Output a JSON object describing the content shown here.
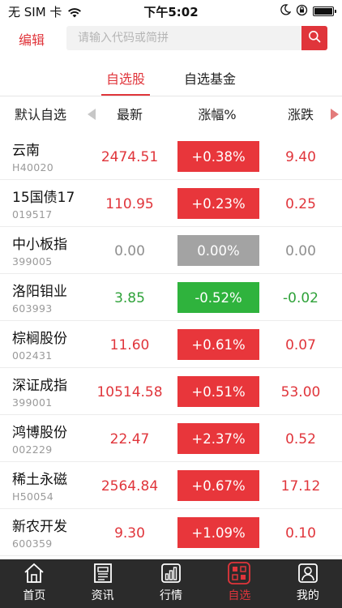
{
  "status_bar": {
    "carrier": "无 SIM 卡",
    "time": "下午5:02"
  },
  "header": {
    "edit_label": "编辑",
    "search_placeholder": "请输入代码或简拼"
  },
  "tabs": [
    {
      "label": "自选股",
      "active": true
    },
    {
      "label": "自选基金",
      "active": false
    }
  ],
  "columns": {
    "name": "默认自选",
    "latest": "最新",
    "change_pct": "涨幅%",
    "change": "涨跌"
  },
  "stocks": [
    {
      "name": "云南",
      "code": "H40020",
      "price": "2474.51",
      "change_pct": "+0.38%",
      "change": "9.40",
      "trend": "up"
    },
    {
      "name": "15国债17",
      "code": "019517",
      "price": "110.95",
      "change_pct": "+0.23%",
      "change": "0.25",
      "trend": "up"
    },
    {
      "name": "中小板指",
      "code": "399005",
      "price": "0.00",
      "change_pct": "0.00%",
      "change": "0.00",
      "trend": "flat"
    },
    {
      "name": "洛阳钼业",
      "code": "603993",
      "price": "3.85",
      "change_pct": "-0.52%",
      "change": "-0.02",
      "trend": "down"
    },
    {
      "name": "棕榈股份",
      "code": "002431",
      "price": "11.60",
      "change_pct": "+0.61%",
      "change": "0.07",
      "trend": "up"
    },
    {
      "name": "深证成指",
      "code": "399001",
      "price": "10514.58",
      "change_pct": "+0.51%",
      "change": "53.00",
      "trend": "up"
    },
    {
      "name": "鸿博股份",
      "code": "002229",
      "price": "22.47",
      "change_pct": "+2.37%",
      "change": "0.52",
      "trend": "up"
    },
    {
      "name": "稀土永磁",
      "code": "H50054",
      "price": "2564.84",
      "change_pct": "+0.67%",
      "change": "17.12",
      "trend": "up"
    },
    {
      "name": "新农开发",
      "code": "600359",
      "price": "9.30",
      "change_pct": "+1.09%",
      "change": "0.10",
      "trend": "up"
    }
  ],
  "tabbar": [
    {
      "label": "首页",
      "icon": "home-icon",
      "active": false
    },
    {
      "label": "资讯",
      "icon": "news-icon",
      "active": false
    },
    {
      "label": "行情",
      "icon": "market-icon",
      "active": false
    },
    {
      "label": "自选",
      "icon": "watchlist-icon",
      "active": true
    },
    {
      "label": "我的",
      "icon": "profile-icon",
      "active": false
    }
  ],
  "colors": {
    "accent": "#e0353b",
    "up": "#e8363b",
    "down": "#2fb33d",
    "flat": "#a3a3a3",
    "tabbar_bg": "#2b2b2b"
  }
}
